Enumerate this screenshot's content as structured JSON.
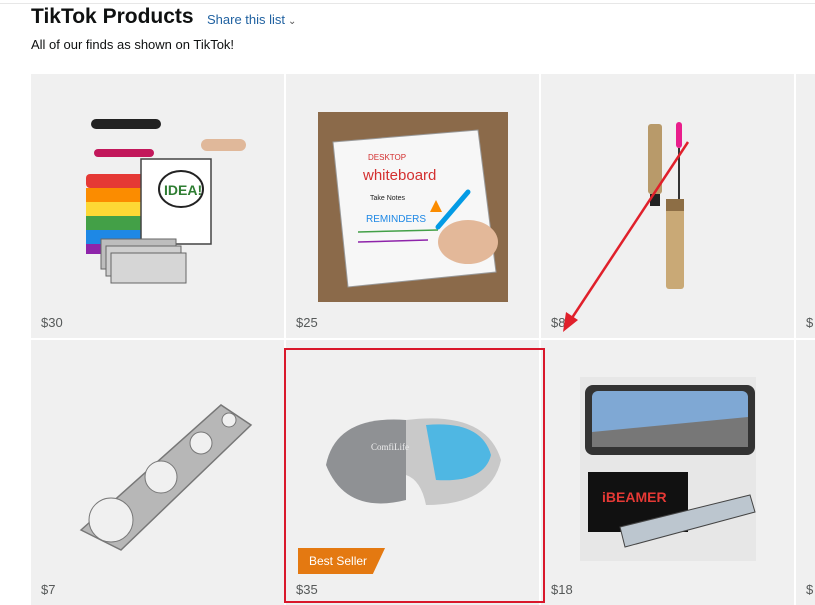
{
  "header": {
    "title": "TikTok Products",
    "share_label": "Share this list",
    "subtitle": "All of our finds as shown on TikTok!"
  },
  "products": [
    {
      "price": "$30",
      "image": "notebook-organizer-set"
    },
    {
      "price": "$25",
      "image": "desktop-whiteboard"
    },
    {
      "price": "$8",
      "image": "mascara"
    },
    {
      "price": "$",
      "image": "partial-product"
    },
    {
      "price": "$7",
      "image": "spaghetti-measuring-tool"
    },
    {
      "price": "$35",
      "image": "gel-seat-cushion",
      "badge": "Best Seller",
      "highlighted": true
    },
    {
      "price": "$18",
      "image": "rearview-mirror"
    },
    {
      "price": "$",
      "image": "partial-product"
    }
  ],
  "whiteboard_text": {
    "top": "DESKTOP",
    "main": "whiteboard",
    "notes": "Take Notes",
    "reminders": "REMINDERS"
  },
  "cushion_brand": "ComfiLife",
  "mirror_brand": "iBEAMER",
  "colors": {
    "accent": "#2162a1",
    "badge": "#e47911",
    "highlight": "#d9182b"
  }
}
